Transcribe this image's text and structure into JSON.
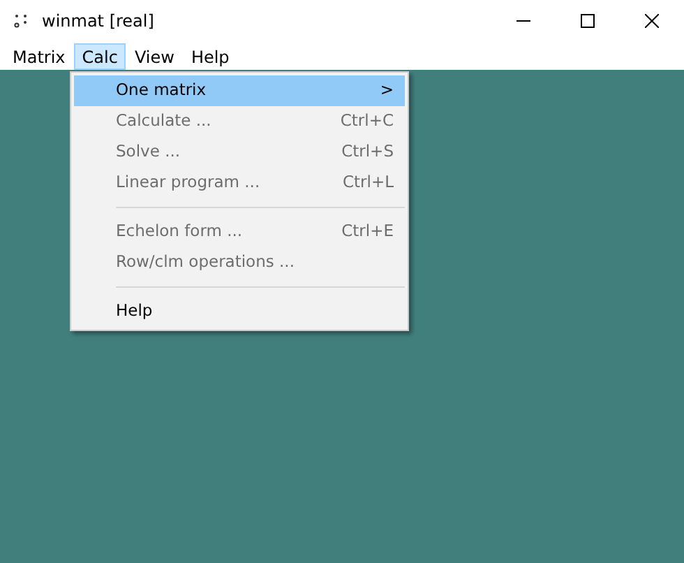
{
  "window": {
    "title": "winmat [real]"
  },
  "menubar": [
    {
      "label": "Matrix",
      "selected": false
    },
    {
      "label": "Calc",
      "selected": true
    },
    {
      "label": "View",
      "selected": false
    },
    {
      "label": "Help",
      "selected": false
    }
  ],
  "menu": [
    {
      "kind": "item",
      "label": "One matrix",
      "submenu": ">",
      "selected": true,
      "disabled": false
    },
    {
      "kind": "item",
      "label": "Calculate ...",
      "shortcut": "Ctrl+C",
      "selected": false,
      "disabled": true
    },
    {
      "kind": "item",
      "label": "Solve ...",
      "shortcut": "Ctrl+S",
      "selected": false,
      "disabled": true
    },
    {
      "kind": "item",
      "label": "Linear program ...",
      "shortcut": "Ctrl+L",
      "selected": false,
      "disabled": true
    },
    {
      "kind": "separator"
    },
    {
      "kind": "item",
      "label": "Echelon form ...",
      "shortcut": "Ctrl+E",
      "selected": false,
      "disabled": true
    },
    {
      "kind": "item",
      "label": "Row/clm operations ...",
      "selected": false,
      "disabled": true
    },
    {
      "kind": "separator"
    },
    {
      "kind": "item",
      "label": "Help",
      "selected": false,
      "disabled": false
    }
  ]
}
